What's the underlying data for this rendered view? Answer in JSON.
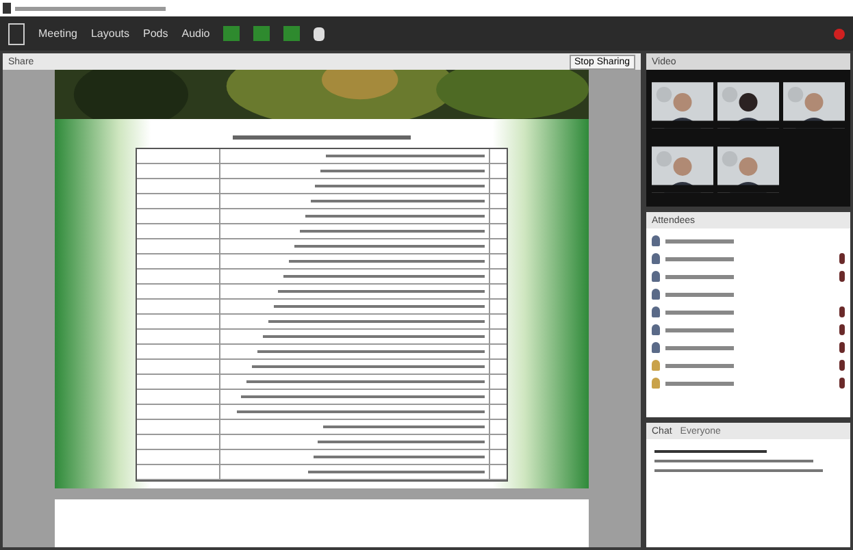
{
  "menu": [
    "Meeting",
    "Layouts",
    "Pods",
    "Audio"
  ],
  "share": {
    "title": "Share",
    "buttons": [
      "Stop Sharing"
    ]
  },
  "video": {
    "title": "Video"
  },
  "attendees": {
    "title": "Attendees",
    "list": [
      {
        "kind": "host",
        "mic": false
      },
      {
        "kind": "host",
        "mic": true
      },
      {
        "kind": "host",
        "mic": true
      },
      {
        "kind": "host",
        "mic": false
      },
      {
        "kind": "host",
        "mic": true
      },
      {
        "kind": "host",
        "mic": true
      },
      {
        "kind": "host",
        "mic": true
      },
      {
        "kind": "participant",
        "mic": true
      },
      {
        "kind": "participant",
        "mic": true
      }
    ]
  },
  "chat": {
    "title": "Chat",
    "tab": "Everyone"
  }
}
